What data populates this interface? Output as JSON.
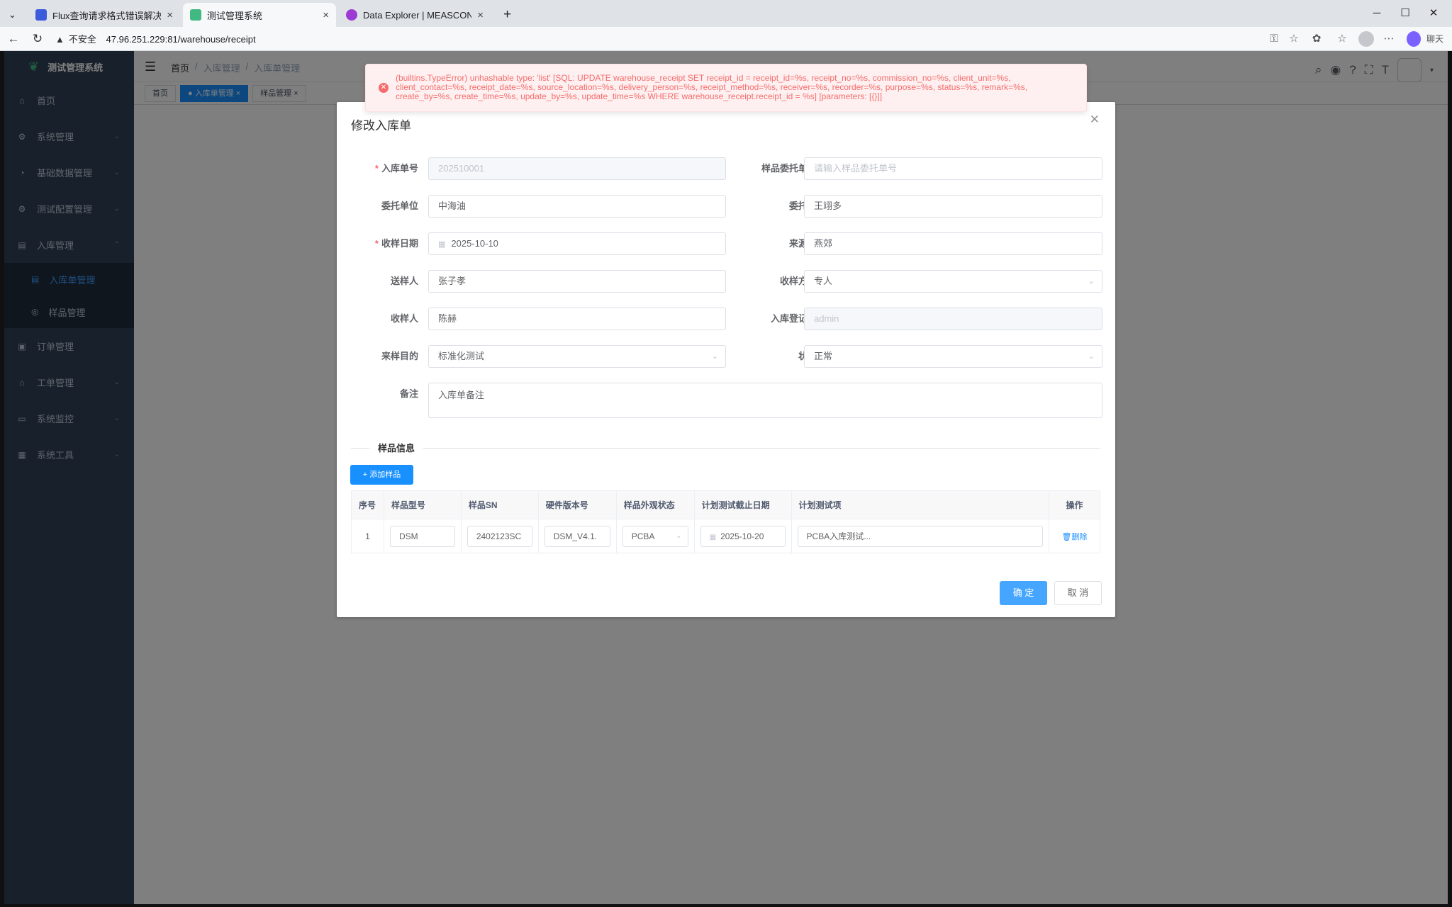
{
  "browser": {
    "tabs": [
      {
        "title": "Flux查询请求格式错误解决方案 - L",
        "icon_color": "#3b5bdb",
        "active": false
      },
      {
        "title": "测试管理系统",
        "icon_color": "#42b983",
        "active": true
      },
      {
        "title": "Data Explorer | MEASCON | InfluxD",
        "icon_color": "#9b3bd3",
        "active": false
      }
    ],
    "new_tab": "+",
    "insecure_label": "不安全",
    "url": "47.96.251.229:81/warehouse/receipt",
    "copilot_label": "聊天"
  },
  "app": {
    "logo_text": "测试管理系统",
    "sidebar": {
      "items": [
        {
          "label": "首页",
          "icon": "home-icon",
          "glyph": "⌂",
          "has_arrow": false
        },
        {
          "label": "系统管理",
          "icon": "gear-icon",
          "glyph": "⚙",
          "has_arrow": true
        },
        {
          "label": "基础数据管理",
          "icon": "dashboard-icon",
          "glyph": "◔",
          "has_arrow": true
        },
        {
          "label": "测试配置管理",
          "icon": "settings-icon",
          "glyph": "⚙",
          "has_arrow": true
        },
        {
          "label": "入库管理",
          "icon": "warehouse-icon",
          "glyph": "▤",
          "has_arrow": true,
          "expanded": true
        }
      ],
      "sub_items": [
        {
          "label": "入库单管理",
          "icon": "document-icon",
          "glyph": "▤",
          "active": true
        },
        {
          "label": "样品管理",
          "icon": "sample-icon",
          "glyph": "◎",
          "active": false
        }
      ],
      "items_after": [
        {
          "label": "订单管理",
          "icon": "order-icon",
          "glyph": "▣",
          "has_arrow": false
        },
        {
          "label": "工单管理",
          "icon": "workorder-icon",
          "glyph": "⌂",
          "has_arrow": true
        },
        {
          "label": "系统监控",
          "icon": "monitor-icon",
          "glyph": "▭",
          "has_arrow": true
        },
        {
          "label": "系统工具",
          "icon": "tool-icon",
          "glyph": "▦",
          "has_arrow": true
        }
      ]
    },
    "breadcrumb": [
      "首页",
      "入库管理",
      "入库单管理"
    ],
    "tags": [
      {
        "label": "首页",
        "active": false
      },
      {
        "label": "● 入库单管理 ×",
        "active": true
      },
      {
        "label": "样品管理 ×",
        "active": false
      }
    ]
  },
  "toast": {
    "type": "error",
    "message": "(builtins.TypeError) unhashable type: 'list' [SQL: UPDATE warehouse_receipt SET receipt_id = receipt_id=%s, receipt_no=%s, commission_no=%s, client_unit=%s, client_contact=%s, receipt_date=%s, source_location=%s, delivery_person=%s, receipt_method=%s, receiver=%s, recorder=%s, purpose=%s, status=%s, remark=%s, create_by=%s, create_time=%s, update_by=%s, update_time=%s WHERE warehouse_receipt.receipt_id = %s] [parameters: [{}]]"
  },
  "dialog": {
    "title": "修改入库单",
    "fields": {
      "receipt_no": {
        "label": "入库单号",
        "value": "202510001",
        "required": true,
        "disabled": true
      },
      "commission_no": {
        "label": "样品委托单号",
        "placeholder": "请输入样品委托单号"
      },
      "client_unit": {
        "label": "委托单位",
        "value": "中海油"
      },
      "client_contact": {
        "label": "委托人",
        "value": "王翊多"
      },
      "receipt_date": {
        "label": "收样日期",
        "value": "2025-10-10",
        "required": true
      },
      "source_location": {
        "label": "来源地",
        "value": "燕郊"
      },
      "delivery_person": {
        "label": "送样人",
        "value": "张子孝"
      },
      "receipt_method": {
        "label": "收样方式",
        "value": "专人"
      },
      "receiver": {
        "label": "收样人",
        "value": "陈赫"
      },
      "recorder": {
        "label": "入库登记人",
        "value": "admin",
        "disabled": true
      },
      "purpose": {
        "label": "来样目的",
        "value": "标准化测试"
      },
      "status": {
        "label": "状态",
        "value": "正常"
      },
      "remark": {
        "label": "备注",
        "value": "入库单备注"
      }
    },
    "section_label": "样品信息",
    "add_sample_label": "+ 添加样品",
    "table": {
      "headers": [
        "序号",
        "样品型号",
        "样品SN",
        "硬件版本号",
        "样品外观状态",
        "计划测试截止日期",
        "计划测试项",
        "操作"
      ],
      "rows": [
        {
          "index": "1",
          "model": "DSM",
          "sn": "2402123SC",
          "hw_version": "DSM_V4.1.",
          "appearance": "PCBA",
          "deadline": "2025-10-20",
          "test_items": "PCBA入库测试...",
          "action": "删除"
        }
      ]
    },
    "confirm_label": "确 定",
    "cancel_label": "取 消"
  }
}
